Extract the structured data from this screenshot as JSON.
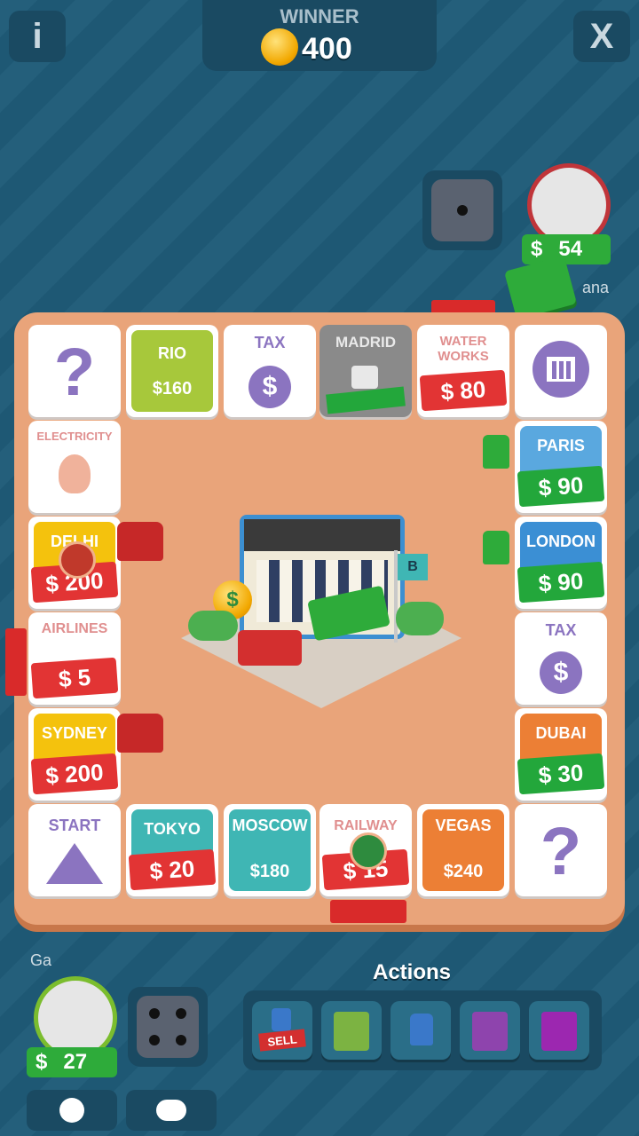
{
  "top": {
    "info_label": "i",
    "close_label": "X",
    "winner_label": "WINNER",
    "winner_amount": "400"
  },
  "opponent": {
    "name": "ana",
    "money": "54",
    "money_symbol": "$",
    "dice_value": 1
  },
  "player": {
    "name": "Ga",
    "money": "27",
    "money_symbol": "$",
    "dice_value": 4
  },
  "board": {
    "top_row": [
      {
        "type": "chance",
        "label": "?"
      },
      {
        "type": "city",
        "name": "RIO",
        "price": "$160",
        "color": "#a7c83b"
      },
      {
        "type": "tax",
        "name": "TAX",
        "symbol": "$"
      },
      {
        "type": "city",
        "name": "MADRID",
        "price": "",
        "color": "#8a8a8a",
        "locked": true
      },
      {
        "type": "utility",
        "name": "WATER WORKS",
        "price": "$ 80",
        "color": "#e23434"
      },
      {
        "type": "jail",
        "label": ""
      }
    ],
    "right_col": [
      {
        "type": "city",
        "name": "PARIS",
        "price": "$ 90",
        "color": "#5aa8df"
      },
      {
        "type": "city",
        "name": "LONDON",
        "price": "$ 90",
        "color": "#3b8fd4"
      },
      {
        "type": "tax",
        "name": "TAX",
        "symbol": "$"
      },
      {
        "type": "city",
        "name": "DUBAI",
        "price": "$ 30",
        "color": "#ec7f35"
      }
    ],
    "left_col": [
      {
        "type": "utility",
        "name": "ELECTRICITY",
        "price": ""
      },
      {
        "type": "city",
        "name": "DELHI",
        "price": "$ 200",
        "color": "#f4c20d"
      },
      {
        "type": "utility",
        "name": "AIRLINES",
        "price": "$ 5"
      },
      {
        "type": "city",
        "name": "SYDNEY",
        "price": "$ 200",
        "color": "#f4c20d"
      }
    ],
    "bottom_row": [
      {
        "type": "start",
        "name": "START"
      },
      {
        "type": "city",
        "name": "TOKYO",
        "price": "$ 20",
        "color": "#3fb6b4"
      },
      {
        "type": "city",
        "name": "MOSCOW",
        "price": "$180",
        "color": "#3fb6b4"
      },
      {
        "type": "utility",
        "name": "RAILWAY",
        "price": "$ 15"
      },
      {
        "type": "city",
        "name": "VEGAS",
        "price": "$240",
        "color": "#ec7f35"
      },
      {
        "type": "chance",
        "label": "?"
      }
    ],
    "center_sign": "B",
    "center_coin": "$"
  },
  "actions": {
    "title": "Actions",
    "sell_label": "SELL",
    "items": [
      "sell-house-icon",
      "mortgage-card-icon",
      "build-house-icon",
      "unmortgage-card-icon",
      "trade-card-icon"
    ]
  }
}
